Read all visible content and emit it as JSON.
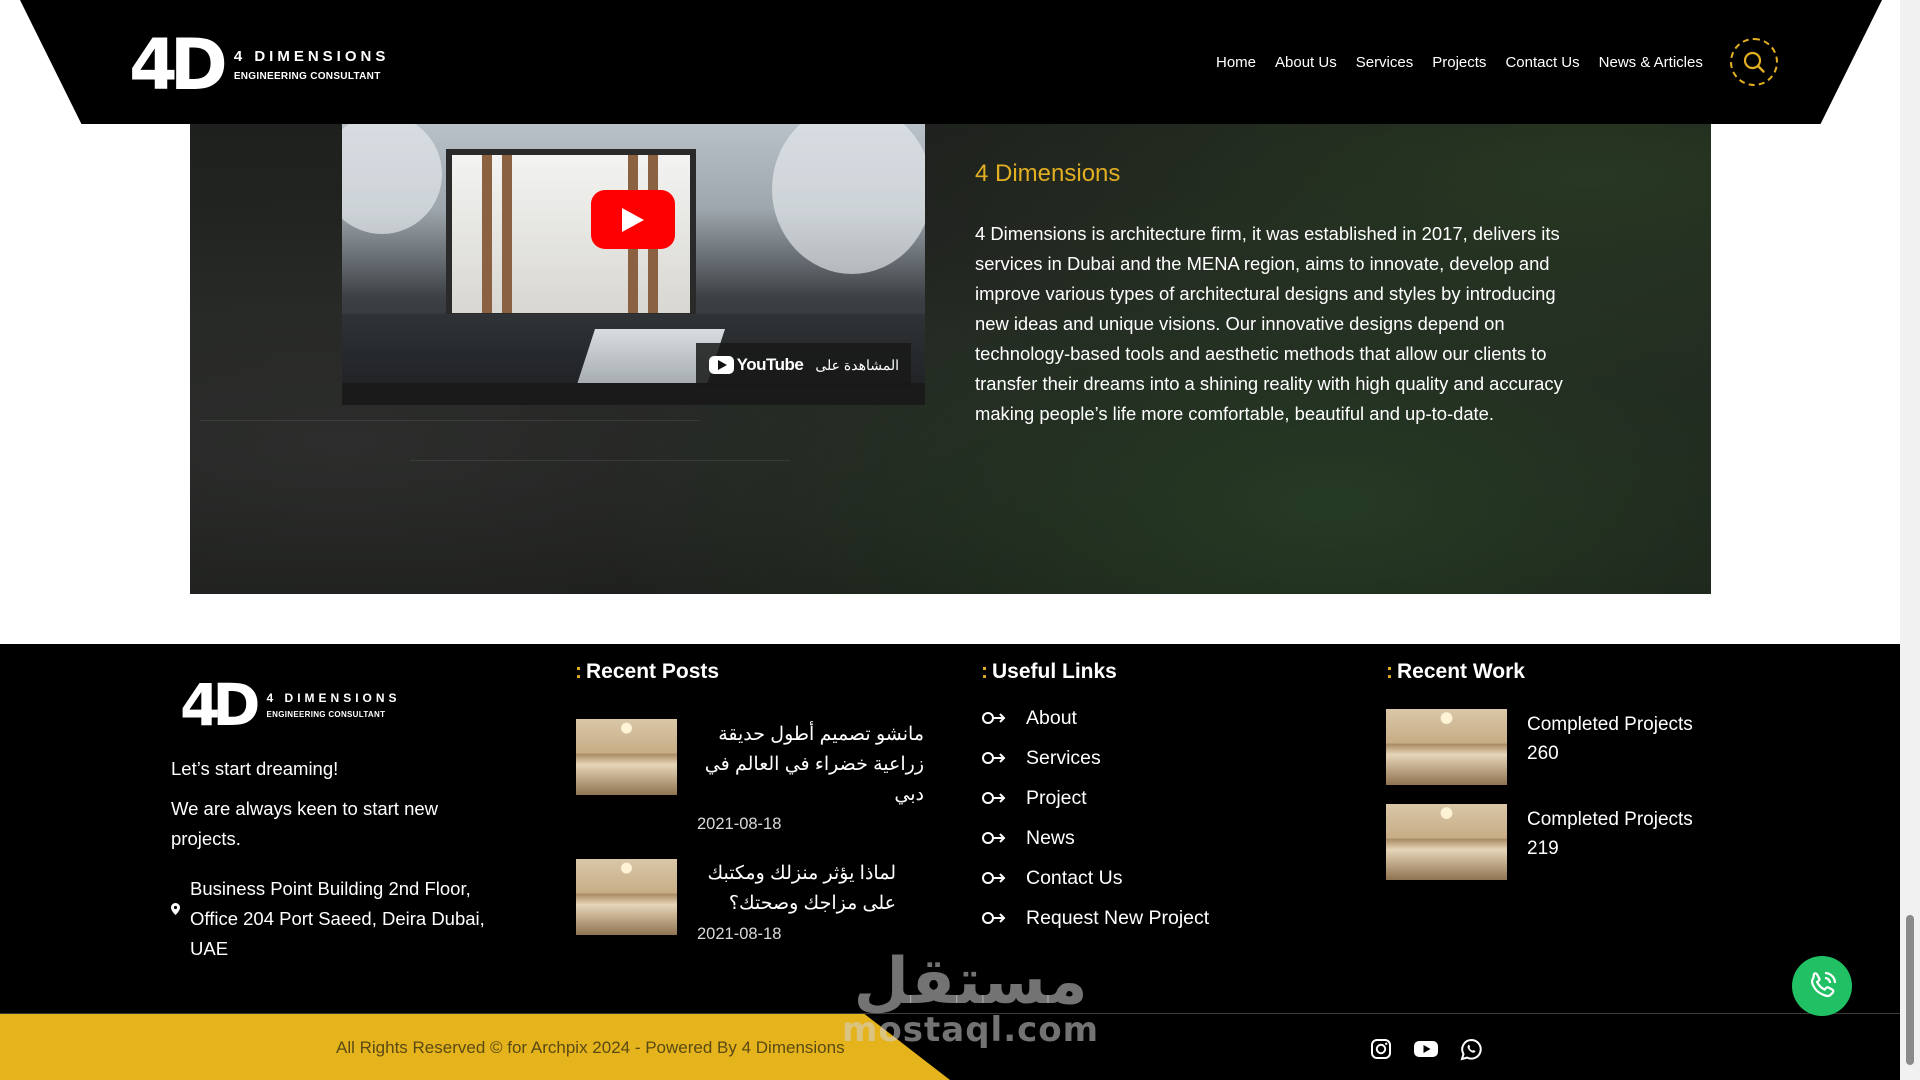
{
  "header": {
    "logo_mark": "4D",
    "logo_brand": "4 DIMENSIONS",
    "logo_sub": "ENGINEERING CONSULTANT",
    "nav": [
      "Home",
      "About Us",
      "Services",
      "Projects",
      "Contact Us",
      "News & Articles"
    ],
    "search_icon": "search-icon"
  },
  "about": {
    "video": {
      "youtube_watch": "المشاهدة على",
      "youtube_label": "YouTube"
    },
    "title": "4 Dimensions",
    "text": "4 Dimensions is architecture firm, it was established in 2017, delivers its services in Dubai and the MENA region, aims to innovate, develop and improve various types of architectural designs and styles by introducing new ideas and unique visions. Our innovative designs depend on technology-based tools and aesthetic methods that allow our clients to transfer their dreams into a shining reality with high quality and accuracy making people’s life more comfortable, beautiful and up-to-date."
  },
  "footer": {
    "logo_mark": "4D",
    "logo_brand": "4 DIMENSIONS",
    "logo_sub": "ENGINEERING CONSULTANT",
    "tagline": "Let’s start dreaming!",
    "keen": "We are always keen to start new projects.",
    "address": "Business Point Building 2nd Floor, Office 204 Port Saeed, Deira Dubai, UAE",
    "recent_posts": {
      "title": "Recent Posts",
      "items": [
        {
          "title": "مانشو تصميم أطول حديقة زراعية خضراء في العالم في دبي",
          "date": "2021-08-18"
        },
        {
          "title": "لماذا يؤثر منزلك ومكتبك على مزاجك وصحتك؟",
          "date": "2021-08-18"
        }
      ]
    },
    "useful_links": {
      "title": "Useful Links",
      "items": [
        "About",
        "Services",
        "Project",
        "News",
        "Contact Us",
        "Request New Project"
      ]
    },
    "recent_work": {
      "title": "Recent Work",
      "items": [
        {
          "line1": "Completed Projects",
          "line2": "260"
        },
        {
          "line1": "Completed Projects",
          "line2": "219"
        }
      ]
    },
    "copyright": "All Rights Reserved © for Archpix 2024 - Powered By 4 Dimensions",
    "social": [
      "instagram-icon",
      "youtube-icon",
      "whatsapp-icon"
    ]
  },
  "watermark": {
    "arabic": "مستقل",
    "latin": "mostaql.com"
  },
  "colors": {
    "accent": "#e2ae22",
    "footer_bg": "#000000",
    "whatsapp": "#21c064"
  }
}
